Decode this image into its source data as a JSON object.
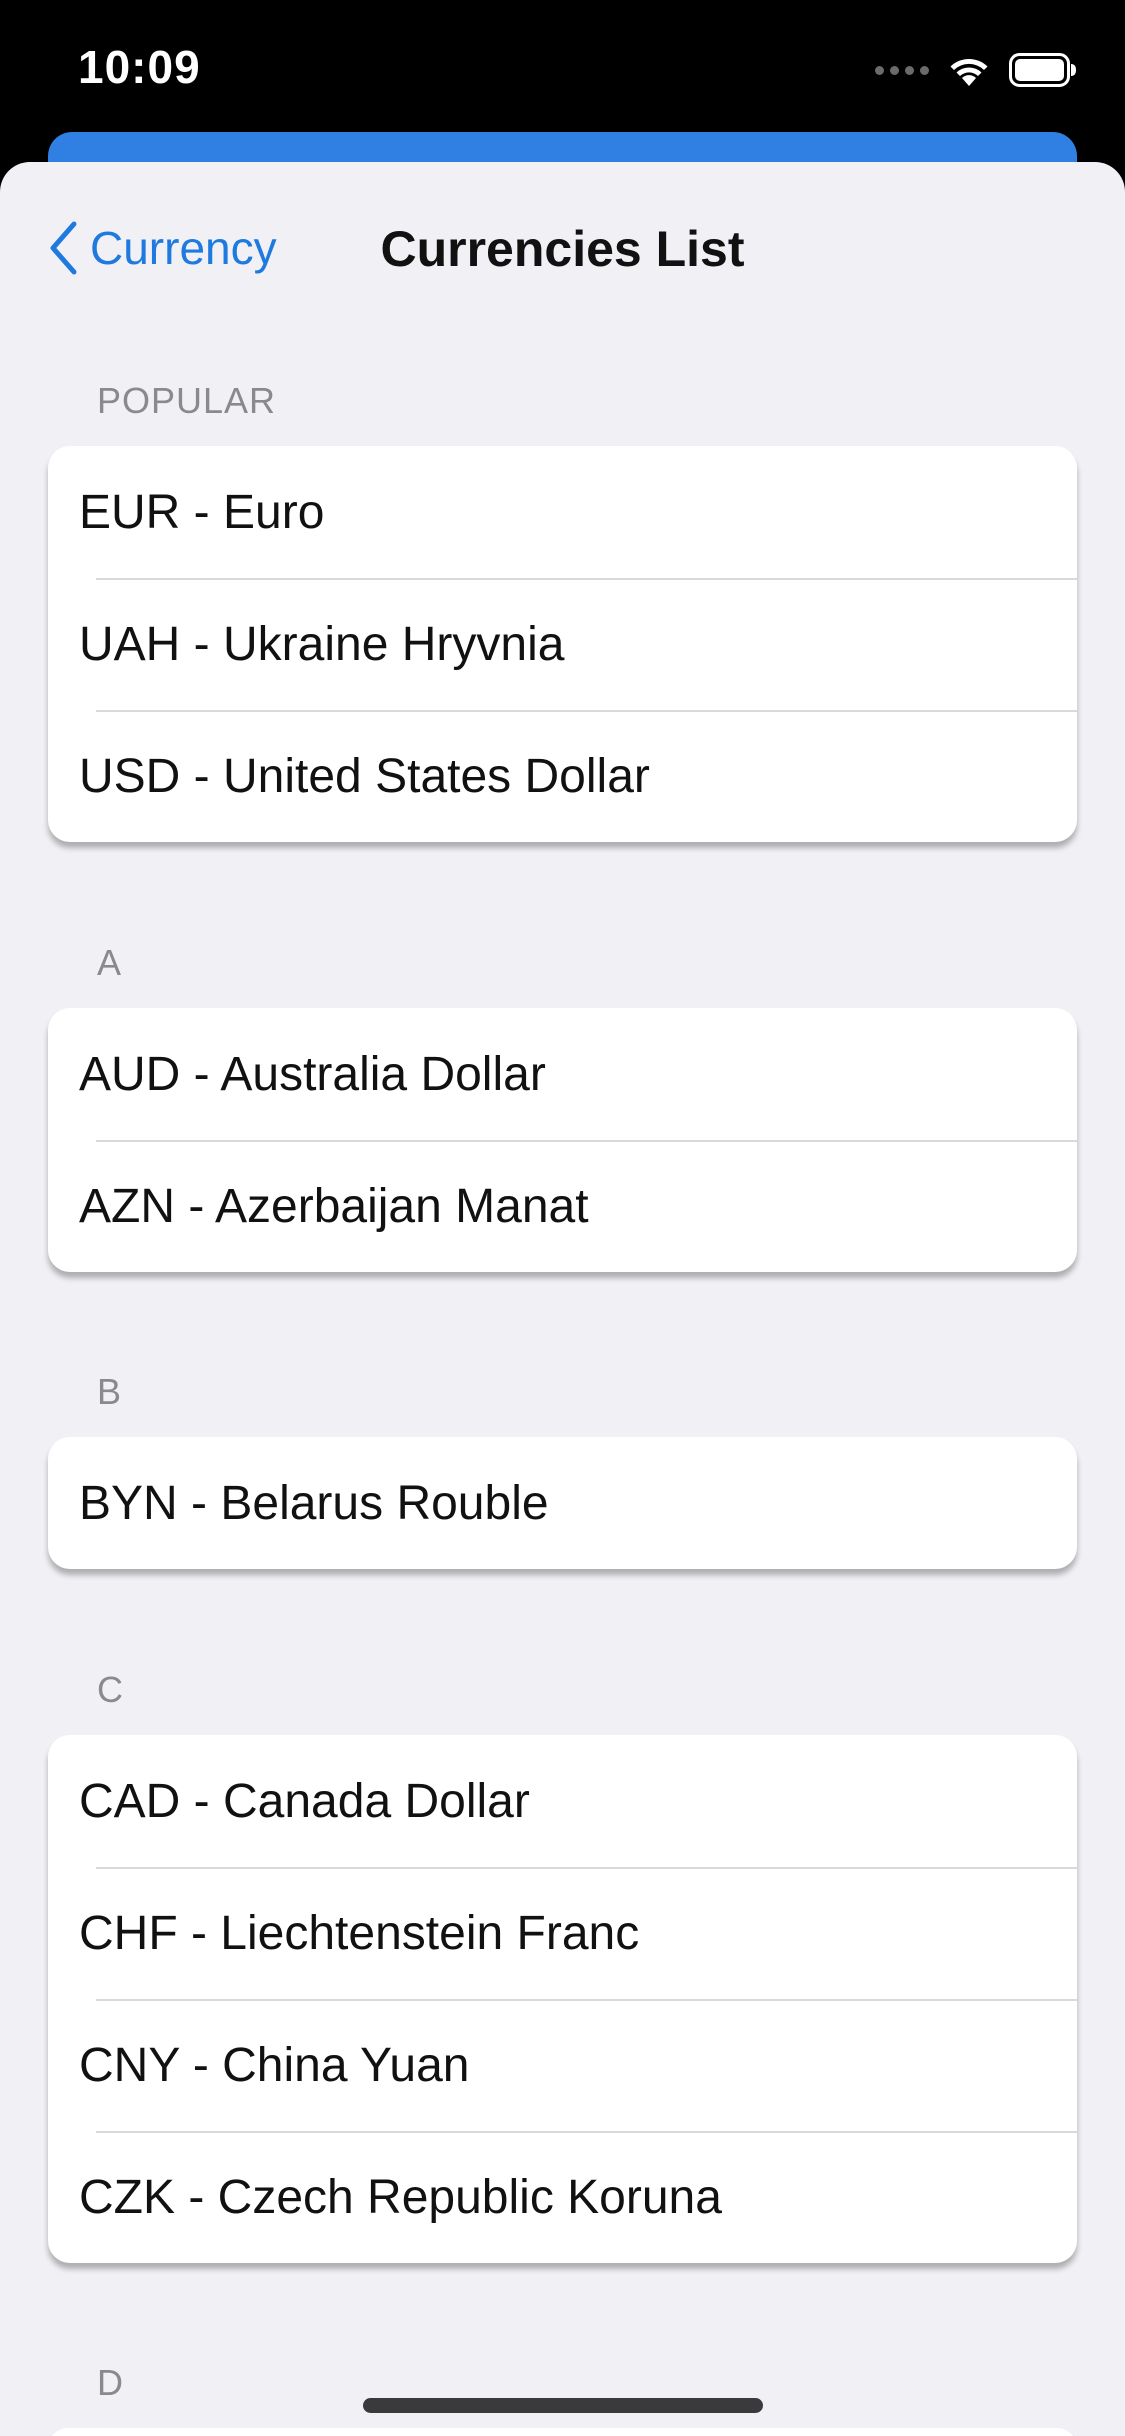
{
  "status_bar": {
    "time": "10:09"
  },
  "navbar": {
    "back_label": "Currency",
    "title": "Currencies List"
  },
  "sections": [
    {
      "header": "POPULAR",
      "items": [
        "EUR - Euro",
        "UAH - Ukraine Hryvnia",
        "USD - United States Dollar"
      ]
    },
    {
      "header": "A",
      "items": [
        "AUD - Australia Dollar",
        "AZN - Azerbaijan Manat"
      ]
    },
    {
      "header": "B",
      "items": [
        "BYN - Belarus Rouble"
      ]
    },
    {
      "header": "C",
      "items": [
        "CAD - Canada Dollar",
        "CHF - Liechtenstein Franc",
        "CNY - China Yuan",
        "CZK - Czech Republic Koruna"
      ]
    },
    {
      "header": "D",
      "items": []
    }
  ],
  "colors": {
    "accent": "#1f7ae0",
    "sheet_background": "#f1f1f5",
    "underlying_sheet": "#2f80e2"
  }
}
